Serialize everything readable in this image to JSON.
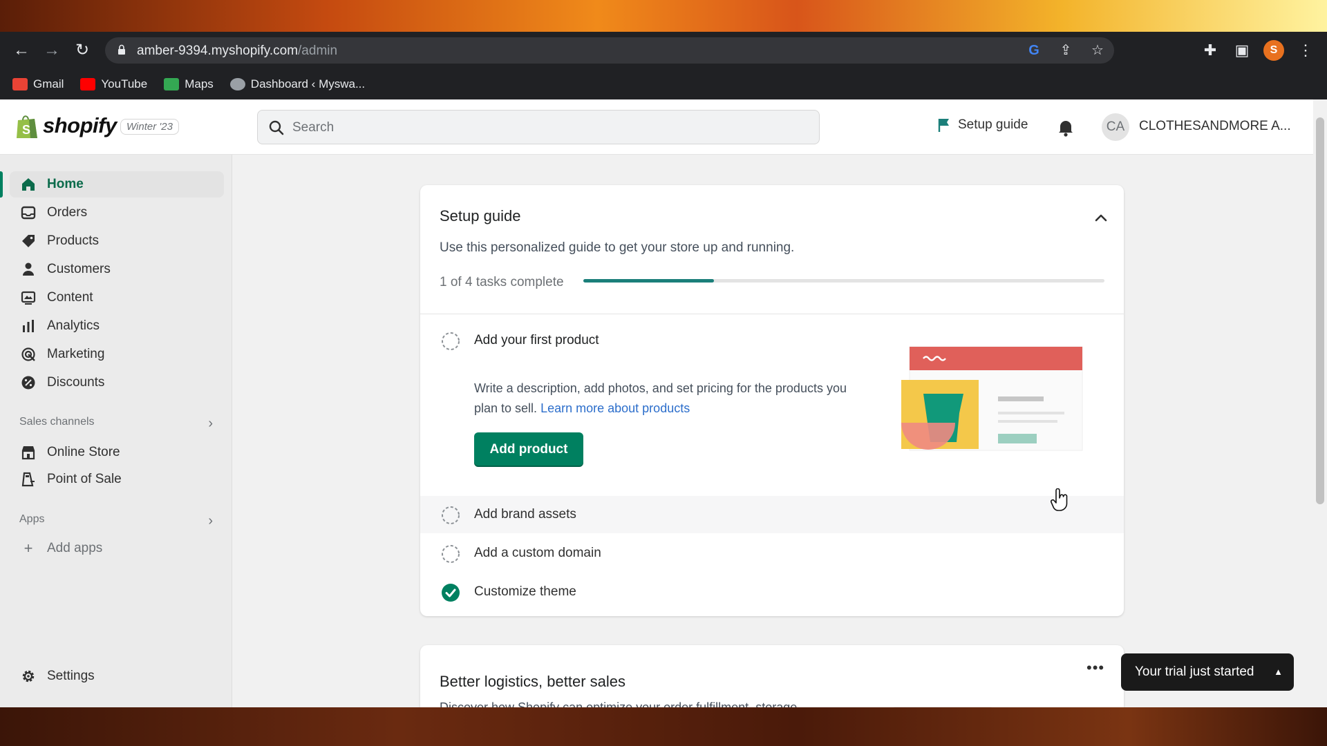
{
  "browser": {
    "url_host": "amber-9394.myshopify.com",
    "url_path": "/admin",
    "profile_initial": "S",
    "bookmarks": [
      {
        "label": "Gmail",
        "icon": "gmail-icon",
        "color": "#ea4335"
      },
      {
        "label": "YouTube",
        "icon": "youtube-icon",
        "color": "#ff0000"
      },
      {
        "label": "Maps",
        "icon": "maps-icon",
        "color": "#34a853"
      },
      {
        "label": "Dashboard ‹ Myswa...",
        "icon": "wordpress-icon",
        "color": "#9aa0a6"
      }
    ]
  },
  "topbar": {
    "logo": "shopify",
    "edition": "Winter '23",
    "search_placeholder": "Search",
    "setup_guide": "Setup guide",
    "avatar_initials": "CA",
    "store_name": "CLOTHESANDMORE A..."
  },
  "sidebar": {
    "items": [
      {
        "label": "Home",
        "icon": "home-icon",
        "active": true
      },
      {
        "label": "Orders",
        "icon": "orders-icon"
      },
      {
        "label": "Products",
        "icon": "tag-icon"
      },
      {
        "label": "Customers",
        "icon": "person-icon"
      },
      {
        "label": "Content",
        "icon": "content-icon"
      },
      {
        "label": "Analytics",
        "icon": "bar-chart-icon"
      },
      {
        "label": "Marketing",
        "icon": "target-icon"
      },
      {
        "label": "Discounts",
        "icon": "discount-icon"
      }
    ],
    "sales_channels_title": "Sales channels",
    "channels": [
      {
        "label": "Online Store",
        "icon": "store-icon"
      },
      {
        "label": "Point of Sale",
        "icon": "pos-icon"
      }
    ],
    "apps_title": "Apps",
    "add_apps": "Add apps",
    "settings": "Settings"
  },
  "setup_card": {
    "title": "Setup guide",
    "subtitle": "Use this personalized guide to get your store up and running.",
    "progress_text": "1 of 4 tasks complete",
    "progress_fraction": 0.25,
    "first_task": {
      "title": "Add your first product",
      "description": "Write a description, add photos, and set pricing for the products you plan to sell.",
      "link": "Learn more about products",
      "button": "Add product"
    },
    "tasks": [
      {
        "label": "Add brand assets",
        "done": false
      },
      {
        "label": "Add a custom domain",
        "done": false
      },
      {
        "label": "Customize theme",
        "done": true
      }
    ]
  },
  "logistics_card": {
    "title": "Better logistics, better sales",
    "subtitle": "Discover how Shopify can optimize your order fulfillment, storage"
  },
  "trial_banner": "Your trial just started",
  "colors": {
    "accent": "#008060",
    "progress": "#1b7f7a",
    "link": "#2c6ecb"
  }
}
